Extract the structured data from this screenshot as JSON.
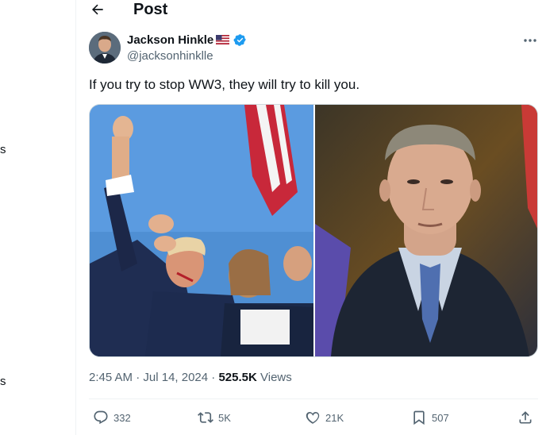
{
  "left_stub": {
    "item_1": "s",
    "item_2": "s"
  },
  "header": {
    "title": "Post"
  },
  "author": {
    "name": "Jackson Hinkle",
    "handle": "@jacksonhinklle"
  },
  "tweet": {
    "text": "If you try to stop WW3, they will try to kill you."
  },
  "meta": {
    "time": "2:45 AM",
    "date": "Jul 14, 2024",
    "views_count": "525.5K",
    "views_label": "Views"
  },
  "actions": {
    "replies": "332",
    "reposts": "5K",
    "likes": "21K",
    "bookmarks": "507"
  },
  "icons": {
    "back": "back-arrow-icon",
    "flag": "us-flag-icon",
    "verified": "verified-badge-icon",
    "more": "more-dots-icon",
    "reply": "reply-icon",
    "repost": "repost-icon",
    "like": "heart-icon",
    "bookmark": "bookmark-icon",
    "share": "share-icon"
  },
  "colors": {
    "verified_blue": "#1d9bf0",
    "text_primary": "#0f1419",
    "text_secondary": "#536471"
  }
}
